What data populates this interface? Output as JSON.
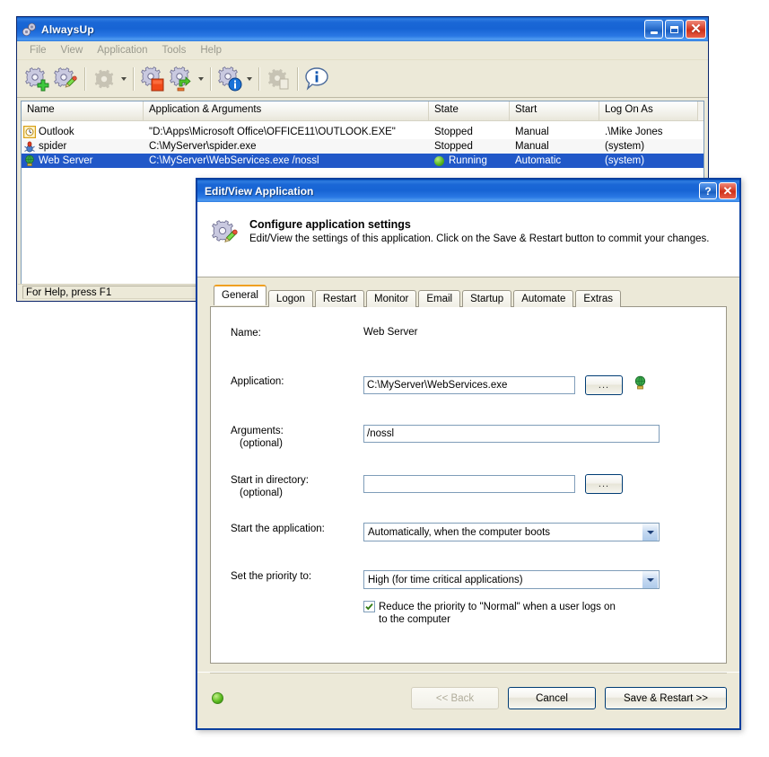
{
  "main_window": {
    "title": "AlwaysUp",
    "icon": "gears-icon",
    "window_buttons": {
      "minimize": "minimize-icon",
      "maximize": "maximize-icon",
      "close": "close-icon"
    },
    "menu": [
      "File",
      "View",
      "Application",
      "Tools",
      "Help"
    ],
    "toolbar": [
      {
        "name": "add-application",
        "icon": "gear-plus-icon"
      },
      {
        "name": "edit-application",
        "icon": "gear-pencil-icon"
      },
      {
        "name": "start-application",
        "icon": "gear-disabled-icon",
        "dropdown": true,
        "disabled": true
      },
      {
        "name": "stop-application",
        "icon": "gear-stop-icon"
      },
      {
        "name": "restart-application",
        "icon": "gear-restart-icon",
        "dropdown": true
      },
      {
        "name": "application-status",
        "icon": "gear-info-icon",
        "dropdown": true
      },
      {
        "name": "report-activity",
        "icon": "gear-report-icon",
        "disabled": true
      },
      {
        "name": "about",
        "icon": "info-balloon-icon"
      }
    ],
    "list": {
      "columns": [
        "Name",
        "Application & Arguments",
        "State",
        "Start",
        "Log On As"
      ],
      "rows": [
        {
          "icon": "clock-icon",
          "name": "Outlook",
          "application": "\"D:\\Apps\\Microsoft Office\\OFFICE11\\OUTLOOK.EXE\"",
          "state": "Stopped",
          "start": "Manual",
          "logon": ".\\Mike Jones",
          "selected": false,
          "running": false
        },
        {
          "icon": "spider-icon",
          "name": "spider",
          "application": "C:\\MyServer\\spider.exe",
          "state": "Stopped",
          "start": "Manual",
          "logon": "(system)",
          "selected": false,
          "running": false
        },
        {
          "icon": "globe-icon",
          "name": "Web Server",
          "application": "C:\\MyServer\\WebServices.exe /nossl",
          "state": "Running",
          "start": "Automatic",
          "logon": "(system)",
          "selected": true,
          "running": true
        }
      ]
    },
    "status_bar": "For Help, press F1"
  },
  "dialog": {
    "title": "Edit/View Application",
    "titlebar_buttons": {
      "help": "?",
      "close": "✕"
    },
    "banner": {
      "icon": "gear-pencil-icon",
      "heading": "Configure application settings",
      "description": "Edit/View the settings of this application. Click on the Save & Restart button to commit your changes."
    },
    "tabs": [
      {
        "label": "General",
        "active": true
      },
      {
        "label": "Logon",
        "active": false
      },
      {
        "label": "Restart",
        "active": false
      },
      {
        "label": "Monitor",
        "active": false
      },
      {
        "label": "Email",
        "active": false
      },
      {
        "label": "Startup",
        "active": false
      },
      {
        "label": "Automate",
        "active": false
      },
      {
        "label": "Extras",
        "active": false
      }
    ],
    "general": {
      "name_label": "Name:",
      "name_value": "Web Server",
      "application_label": "Application:",
      "application_value": "C:\\MyServer\\WebServices.exe",
      "application_browse": "...",
      "application_icon": "globe-icon",
      "arguments_label": "Arguments:",
      "arguments_sublabel": "(optional)",
      "arguments_value": "/nossl",
      "startdir_label": "Start in directory:",
      "startdir_sublabel": "(optional)",
      "startdir_value": "",
      "startdir_browse": "...",
      "start_app_label": "Start the application:",
      "start_app_value": "Automatically, when the computer boots",
      "priority_label": "Set the priority to:",
      "priority_value": "High (for time critical applications)",
      "reduce_priority_checked": true,
      "reduce_priority_line1": "Reduce the priority to \"Normal\" when a user logs on",
      "reduce_priority_line2": "to the computer"
    },
    "footer": {
      "led": "status-led-green",
      "back": "<< Back",
      "cancel": "Cancel",
      "save": "Save & Restart >>"
    }
  },
  "colors": {
    "titlebar_blue": "#1764d4",
    "selection_blue": "#2158c8",
    "window_face": "#ece9d8",
    "active_tab_accent": "#f0a020",
    "status_green": "#5ab821"
  }
}
